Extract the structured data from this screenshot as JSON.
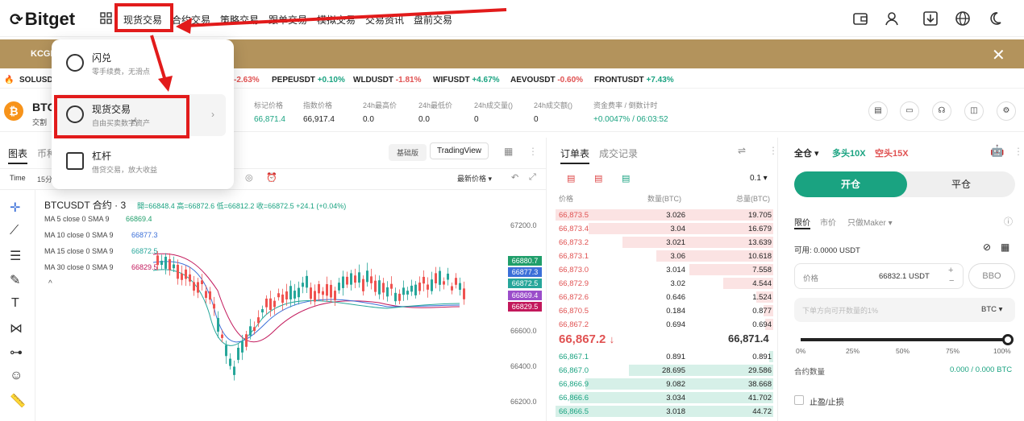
{
  "nav": {
    "logo": "Bitget",
    "items": [
      "现货交易",
      "合约交易",
      "策略交易",
      "跟单交易",
      "模拟交易",
      "交易资讯",
      "盘前交易"
    ]
  },
  "banner": {
    "text": "KCGI"
  },
  "ticker": [
    {
      "sym": "SOLUSDT",
      "chg": ""
    },
    {
      "sym": "",
      "chg": "-2.63%"
    },
    {
      "sym": "PEPEUSDT",
      "chg": "+0.10%"
    },
    {
      "sym": "WLDUSDT",
      "chg": "-1.81%"
    },
    {
      "sym": "WIFUSDT",
      "chg": "+4.67%"
    },
    {
      "sym": "AEVOUSDT",
      "chg": "-0.60%"
    },
    {
      "sym": "FRONTUSDT",
      "chg": "+7.43%"
    }
  ],
  "pair": {
    "symbol": "BTC",
    "sub": "交割",
    "stats": [
      {
        "label": "标记价格",
        "value": "66,871.4"
      },
      {
        "label": "指数价格",
        "value": "66,917.4"
      },
      {
        "label": "24h最高价",
        "value": "0.0"
      },
      {
        "label": "24h最低价",
        "value": "0.0"
      },
      {
        "label": "24h成交量()",
        "value": "0"
      },
      {
        "label": "24h成交额()",
        "value": "0"
      },
      {
        "label": "资金费率 / 倒数计时",
        "value": "+0.0047% / 06:03:52"
      }
    ]
  },
  "chart": {
    "tabs": [
      "图表",
      "币种"
    ],
    "modes": [
      "基础版",
      "TradingView"
    ],
    "time_label": "Time",
    "interval": "15分",
    "latest_price_label": "最新价格",
    "title": "BTCUSDT 合约 · 3",
    "ohlc": "開=66848.4 高=66872.6 低=66812.2 收=66872.5 +24.1 (+0.04%)",
    "ma": [
      {
        "label": "MA 5 close 0 SMA 9",
        "value": "66869.4"
      },
      {
        "label": "MA 10 close 0 SMA 9",
        "value": "66877.3"
      },
      {
        "label": "MA 15 close 0 SMA 9",
        "value": "66872.5"
      },
      {
        "label": "MA 30 close 0 SMA 9",
        "value": "66829.5"
      }
    ],
    "y_ticks": [
      "67200.0",
      "66600.0",
      "66400.0",
      "66200.0"
    ],
    "price_tags": [
      {
        "v": "66880.7",
        "color": "#1f9e6a"
      },
      {
        "v": "66877.3",
        "color": "#3b6fd8"
      },
      {
        "v": "66872.5",
        "color": "#26a69a"
      },
      {
        "v": "66869.4",
        "color": "#9b4dca"
      },
      {
        "v": "66829.5",
        "color": "#c2185b"
      }
    ]
  },
  "orderbook": {
    "tabs": [
      "订单表",
      "成交记录"
    ],
    "precision": "0.1",
    "headers": [
      "价格",
      "数量(BTC)",
      "总量(BTC)"
    ],
    "asks": [
      [
        "66,873.5",
        "3.026",
        "19.705"
      ],
      [
        "66,873.4",
        "3.04",
        "16.679"
      ],
      [
        "66,873.2",
        "3.021",
        "13.639"
      ],
      [
        "66,873.1",
        "3.06",
        "10.618"
      ],
      [
        "66,873.0",
        "3.014",
        "7.558"
      ],
      [
        "66,872.9",
        "3.02",
        "4.544"
      ],
      [
        "66,872.6",
        "0.646",
        "1.524"
      ],
      [
        "66,870.5",
        "0.184",
        "0.877"
      ],
      [
        "66,867.2",
        "0.694",
        "0.694"
      ]
    ],
    "last": "66,867.2",
    "last_arrow": "↓",
    "mark": "66,871.4",
    "bids": [
      [
        "66,867.1",
        "0.891",
        "0.891"
      ],
      [
        "66,867.0",
        "28.695",
        "29.586"
      ],
      [
        "66,866.9",
        "9.082",
        "38.668"
      ],
      [
        "66,866.6",
        "3.034",
        "41.702"
      ],
      [
        "66,866.5",
        "3.018",
        "44.72"
      ]
    ]
  },
  "trade": {
    "margin_mode": "全仓",
    "long": "多头10X",
    "short": "空头15X",
    "open": "开仓",
    "close": "平仓",
    "order_types": [
      "限价",
      "市价",
      "只做Maker"
    ],
    "available": "可用: 0.0000 USDT",
    "price_label": "价格",
    "price_value": "66832.1 USDT",
    "bbo": "BBO",
    "qty_placeholder": "下单方向可开数量的1%",
    "qty_unit": "BTC",
    "slider_marks": [
      "0%",
      "25%",
      "50%",
      "75%",
      "100%"
    ],
    "contract_qty_label": "合约数量",
    "contract_qty_value": "0.000 / 0.000 BTC",
    "tpsl": "止盈/止损"
  },
  "dropdown": {
    "items": [
      {
        "title": "闪兑",
        "sub": "零手续费，无滑点"
      },
      {
        "title": "现货交易",
        "sub": "自由买卖数字资产"
      },
      {
        "title": "杠杆",
        "sub": "借贷交易，放大收益"
      }
    ]
  }
}
